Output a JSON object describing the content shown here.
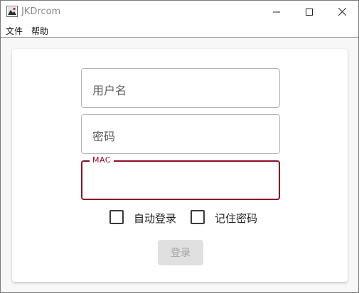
{
  "window": {
    "title": "JKDrcom",
    "icon": "app-logo-icon",
    "controls": [
      "minimize-icon",
      "maximize-icon",
      "close-icon"
    ]
  },
  "menu": {
    "file": "文件",
    "help": "帮助"
  },
  "form": {
    "username_placeholder": "用户名",
    "password_placeholder": "密码",
    "mac_label": "MAC",
    "mac_value": "",
    "auto_login_label": "自动登录",
    "auto_login_checked": false,
    "remember_password_label": "记住密码",
    "remember_password_checked": false,
    "login_button": "登录",
    "login_enabled": false
  },
  "colors": {
    "accent": "#8a0f26",
    "disabled_button_bg": "#e0e0e0",
    "disabled_button_text": "#a3a3a3"
  }
}
